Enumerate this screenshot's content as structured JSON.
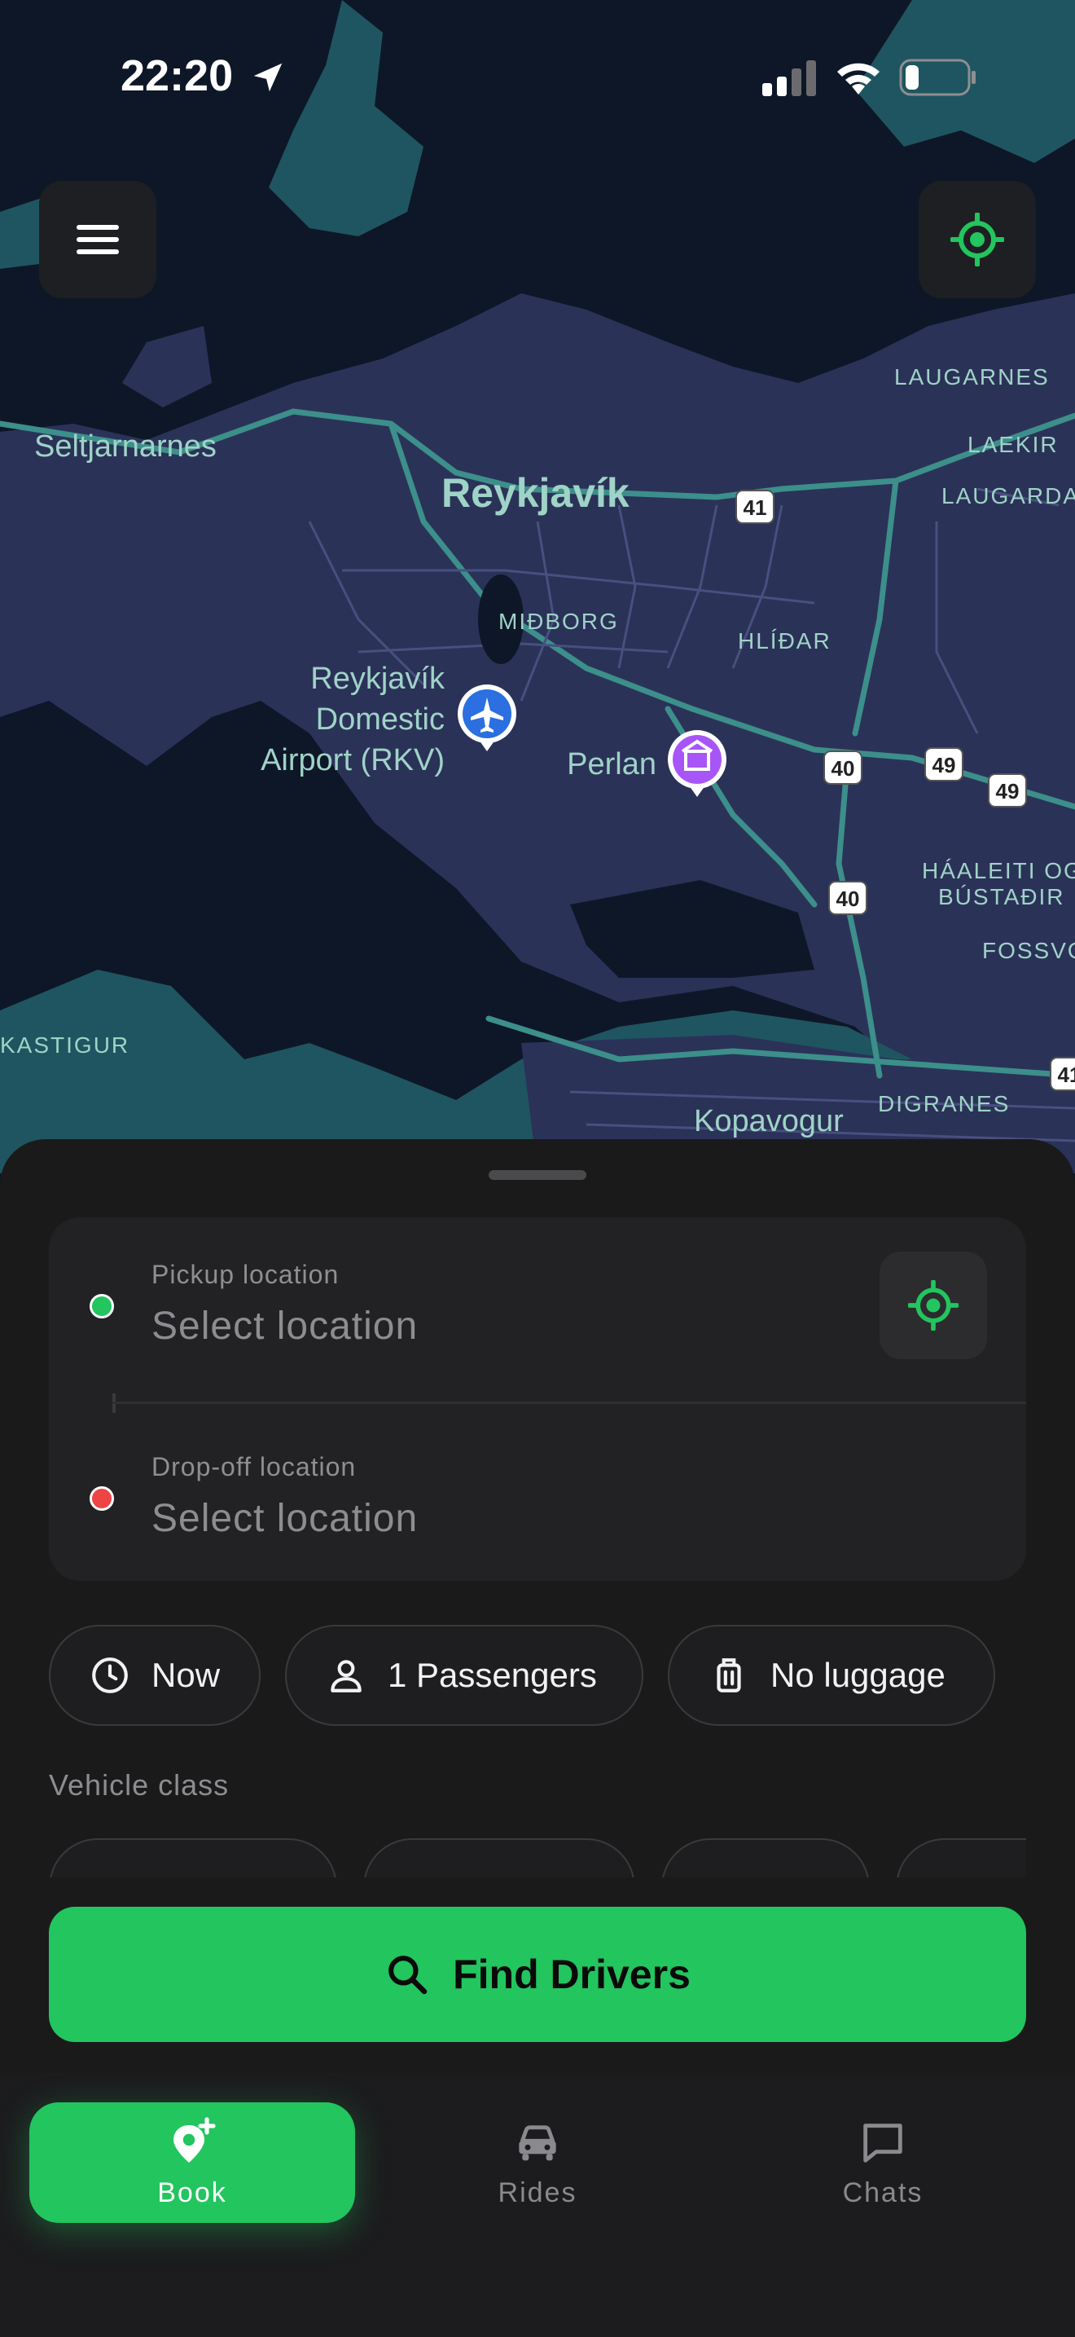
{
  "status": {
    "time": "22:20"
  },
  "map": {
    "labels": {
      "seltjarnarnes": "Seltjarnarnes",
      "reykjavik": "Reykjavík",
      "midborg": "MIÐBORG",
      "hlidar": "HLÍÐAR",
      "laugarnes": "LAUGARNES",
      "laekir": "LAEKIR",
      "laugarda": "LAUGARDA",
      "airport_line1": "Reykjavík",
      "airport_line2": "Domestic",
      "airport_line3": "Airport (RKV)",
      "perlan": "Perlan",
      "haaleiti_line1": "HÁALEITI OG",
      "haaleiti_line2": "BÚSTAÐIR",
      "fossvo": "FOSSVO",
      "kastigur": "KASTIGUR",
      "digranes": "DIGRANES",
      "kopavogur": "Kopavogur"
    },
    "shields": {
      "s41a": "41",
      "s40a": "40",
      "s49a": "49",
      "s49b": "49",
      "s40b": "40",
      "s41b": "41"
    }
  },
  "booking": {
    "pickup": {
      "label": "Pickup location",
      "value": "Select location",
      "dot_color": "#22c55e"
    },
    "dropoff": {
      "label": "Drop-off location",
      "value": "Select location",
      "dot_color": "#ef4444"
    },
    "chips": {
      "time": "Now",
      "passengers": "1 Passengers",
      "luggage": "No luggage"
    },
    "vehicle_class_label": "Vehicle class",
    "find_button": "Find Drivers"
  },
  "tabs": {
    "book": "Book",
    "rides": "Rides",
    "chats": "Chats"
  },
  "colors": {
    "accent": "#22c55e",
    "sheet": "#1a1a1b",
    "map_land": "#2a3257",
    "map_water": "#0e1728"
  },
  "icons": {
    "menu": "menu-icon",
    "locate": "crosshair-icon",
    "time": "clock-icon",
    "passengers": "person-icon",
    "luggage": "luggage-icon",
    "search": "search-icon",
    "book": "map-pin-plus-icon",
    "rides": "car-icon",
    "chats": "chat-icon"
  }
}
